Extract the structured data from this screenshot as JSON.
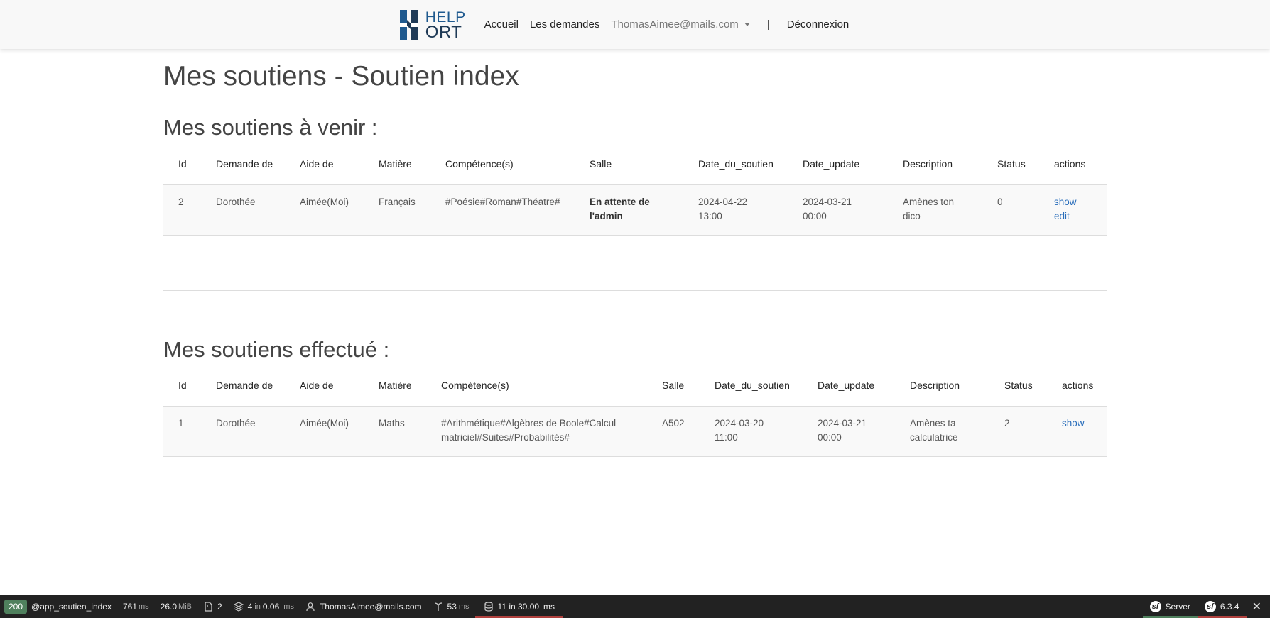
{
  "nav": {
    "logo_top": "HELP",
    "logo_bottom": "ORT",
    "links": [
      "Accueil",
      "Les demandes"
    ],
    "user": "ThomasAimee@mails.com",
    "separator": "|",
    "logout": "Déconnexion"
  },
  "page": {
    "title": "Mes soutiens - Soutien index"
  },
  "upcoming": {
    "heading": "Mes soutiens à venir :",
    "columns": [
      "Id",
      "Demande de",
      "Aide de",
      "Matière",
      "Compétence(s)",
      "Salle",
      "Date_du_soutien",
      "Date_update",
      "Description",
      "Status",
      "actions"
    ],
    "rows": [
      {
        "id": "2",
        "demande_de": "Dorothée",
        "aide_de": "Aimée(Moi)",
        "matiere": "Français",
        "competences": "#Poésie#Roman#Théatre#",
        "salle_line1": "En attente de",
        "salle_line2": "l'admin",
        "date_soutien_1": "2024-04-22",
        "date_soutien_2": "13:00",
        "date_update_1": "2024-03-21",
        "date_update_2": "00:00",
        "description_1": "Amènes ton",
        "description_2": "dico",
        "status": "0",
        "action_show": "show",
        "action_edit": "edit"
      }
    ]
  },
  "done": {
    "heading": "Mes soutiens effectué :",
    "columns": [
      "Id",
      "Demande de",
      "Aide de",
      "Matière",
      "Compétence(s)",
      "Salle",
      "Date_du_soutien",
      "Date_update",
      "Description",
      "Status",
      "actions"
    ],
    "rows": [
      {
        "id": "1",
        "demande_de": "Dorothée",
        "aide_de": "Aimée(Moi)",
        "matiere": "Maths",
        "competences_1": "#Arithmétique#Algèbres de Boole#Calcul",
        "competences_2": "matriciel#Suites#Probabilités#",
        "salle": "A502",
        "date_soutien_1": "2024-03-20",
        "date_soutien_2": "11:00",
        "date_update_1": "2024-03-21",
        "date_update_2": "00:00",
        "description_1": "Amènes ta",
        "description_2": "calculatrice",
        "status": "2",
        "action_show": "show"
      }
    ]
  },
  "toolbar": {
    "status_code": "200",
    "route": "@app_soutien_index",
    "time": "761",
    "time_unit": "ms",
    "memory": "26.0",
    "memory_unit": "MiB",
    "logs": "2",
    "forms": "4",
    "forms_in": "in",
    "forms_time": "0.06",
    "forms_unit": "ms",
    "user": "ThomasAimee@mails.com",
    "twig_time": "53",
    "twig_unit": "ms",
    "db": "11 in 30.00",
    "db_unit": "ms",
    "server": "Server",
    "version": "6.3.4",
    "colors": {
      "status_ok": "#4f805d",
      "error": "#b0413e"
    }
  }
}
